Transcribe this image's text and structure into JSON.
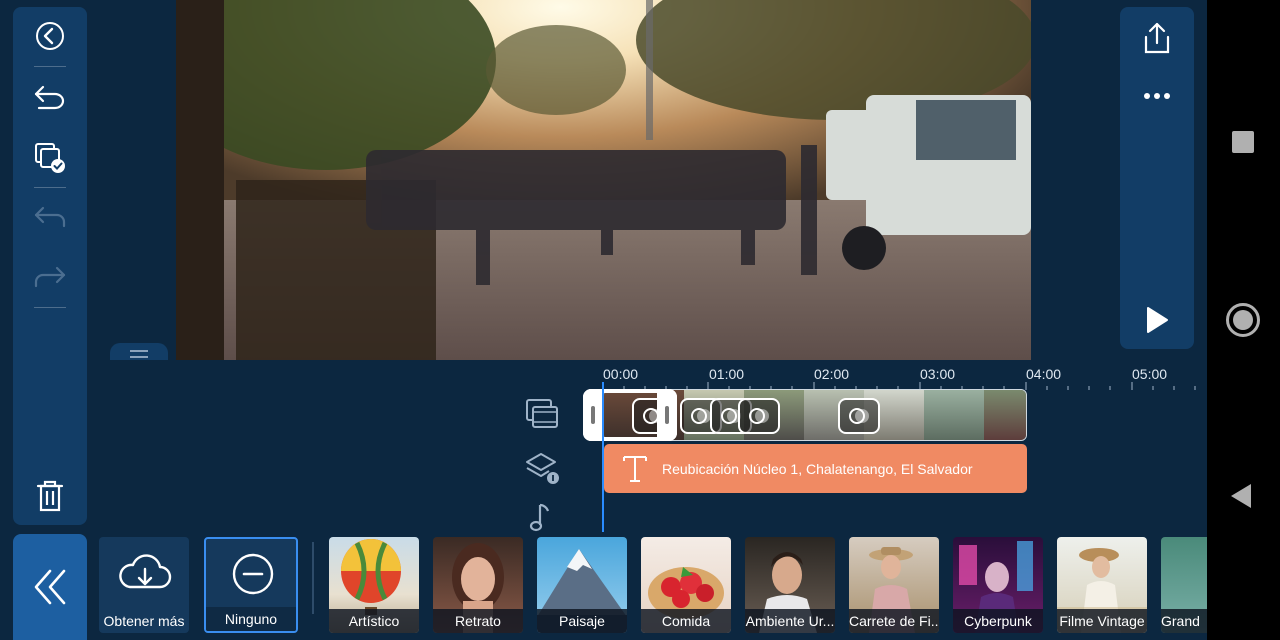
{
  "left_toolbar": {
    "items": [
      "back-button",
      "undo-to-start-button",
      "copy-apply-button",
      "undo-button",
      "redo-button"
    ],
    "delete": "delete-button"
  },
  "right_toolbar": {
    "export": "export-button",
    "more": "more-button",
    "play": "play-button"
  },
  "timeline": {
    "ruler": [
      "00:00",
      "01:00",
      "02:00",
      "03:00",
      "04:00",
      "05:00"
    ],
    "text_clip": "Reubicación Núcleo 1, Chalatenango, El Salvador"
  },
  "filters": {
    "get_more": "Obtener más",
    "none": "Ninguno",
    "items": [
      "Artístico",
      "Retrato",
      "Paisaje",
      "Comida",
      "Ambiente Ur...",
      "Carrete de Fi...",
      "Cyberpunk",
      "Filme Vintage",
      "Grand"
    ]
  },
  "colors": {
    "background": "#0c2740",
    "panel": "#123d66",
    "accent": "#1d5fa1",
    "text_clip": "#f08a63",
    "playhead": "#2a8cff"
  }
}
